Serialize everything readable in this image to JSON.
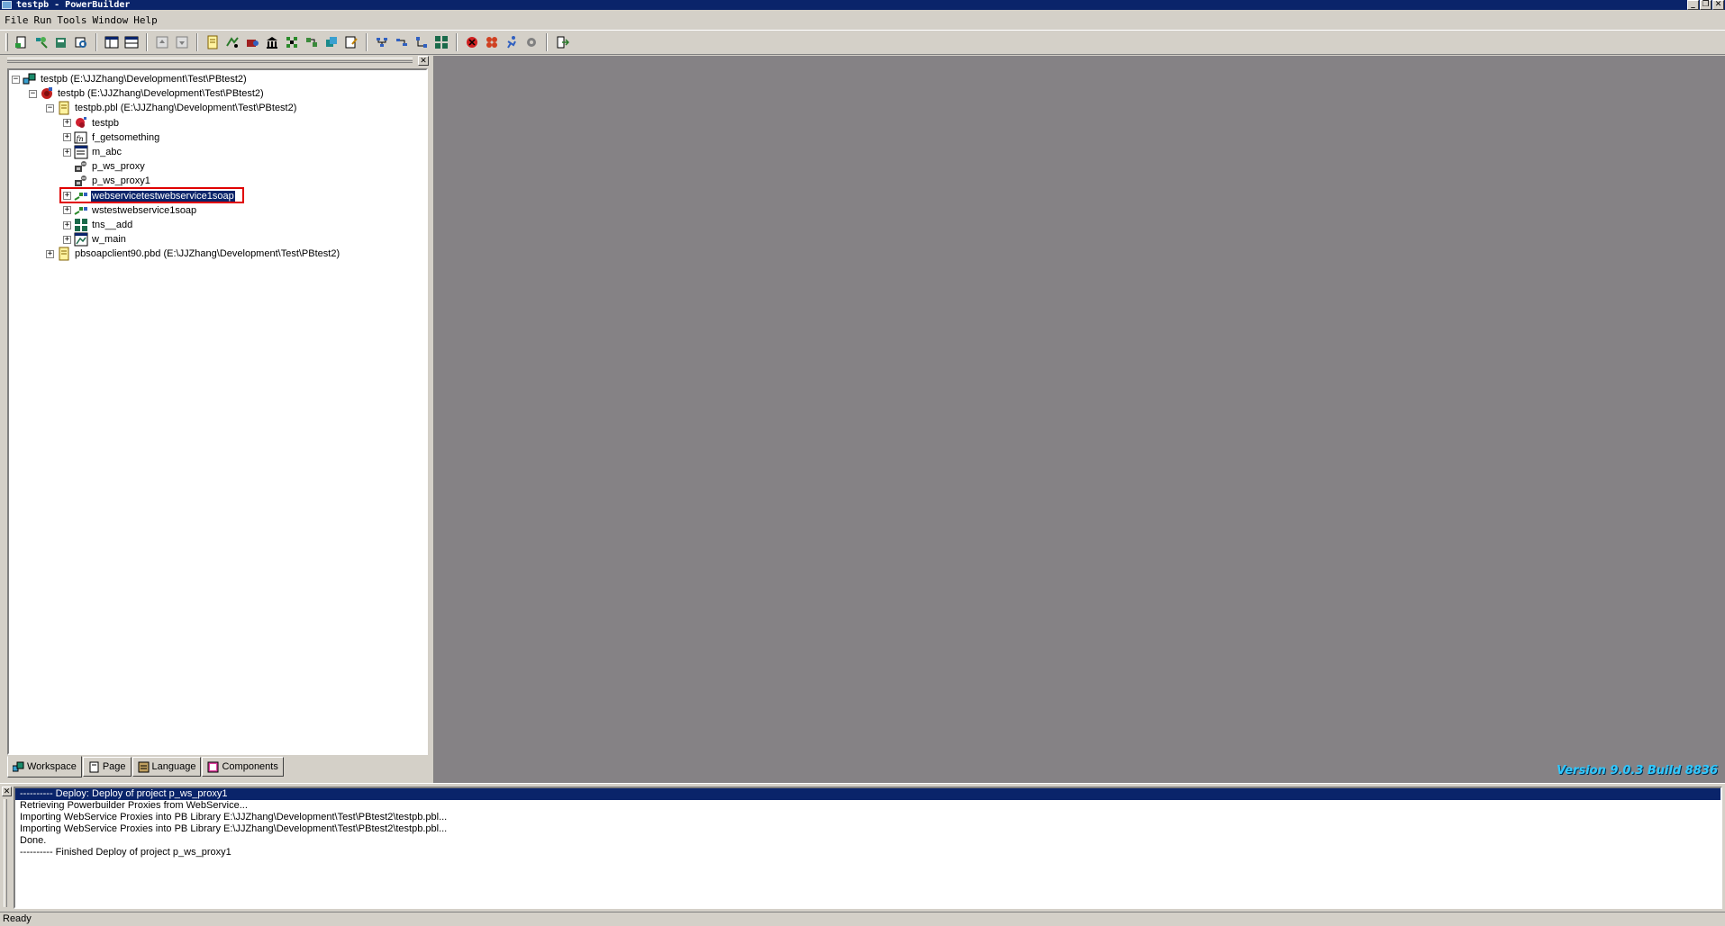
{
  "window": {
    "title": "testpb - PowerBuilder",
    "minimize_glyph": "_",
    "restore_glyph": "❐",
    "close_glyph": "✕"
  },
  "menu": [
    "File",
    "Run",
    "Tools",
    "Window",
    "Help"
  ],
  "toolbar_icons": [
    "new-icon",
    "inherit-icon",
    "open-icon",
    "preview-icon",
    "separator",
    "window-layout-icon",
    "view-layout-icon",
    "separator",
    "step-icon",
    "step-out-icon",
    "separator",
    "library-icon",
    "debug-icon",
    "run-icon",
    "db-icon",
    "component-icon",
    "build-icon",
    "deploy-icon",
    "edit-icon",
    "separator",
    "object-browser-icon",
    "window-painter-icon",
    "user-object-icon",
    "structure-icon",
    "separator",
    "stop-icon",
    "multi-run-icon",
    "runner-icon",
    "gear-icon",
    "separator",
    "exit-icon"
  ],
  "workspace": {
    "close_glyph": "✕",
    "tree": [
      {
        "label": "testpb (E:\\JJZhang\\Development\\Test\\PBtest2)",
        "icon": "workspace-icon",
        "expander": "−",
        "level": 0
      },
      {
        "label": "testpb (E:\\JJZhang\\Development\\Test\\PBtest2)",
        "icon": "target-icon",
        "expander": "−",
        "level": 1
      },
      {
        "label": "testpb.pbl (E:\\JJZhang\\Development\\Test\\PBtest2)",
        "icon": "library-icon",
        "expander": "−",
        "level": 2
      },
      {
        "label": "testpb",
        "icon": "application-icon",
        "expander": "+",
        "level": 3
      },
      {
        "label": "f_getsomething",
        "icon": "function-icon",
        "expander": "+",
        "level": 3
      },
      {
        "label": "m_abc",
        "icon": "menu-icon",
        "expander": "+",
        "level": 3
      },
      {
        "label": "p_ws_proxy",
        "icon": "project-icon",
        "expander": "",
        "level": 3
      },
      {
        "label": "p_ws_proxy1",
        "icon": "project-icon",
        "expander": "",
        "level": 3
      },
      {
        "label": "webservicetestwebservice1soap",
        "icon": "proxy-object-icon",
        "expander": "+",
        "level": 3,
        "selected": true
      },
      {
        "label": "wstestwebservice1soap",
        "icon": "proxy-object-icon",
        "expander": "+",
        "level": 3
      },
      {
        "label": "tns__add",
        "icon": "structure-icon",
        "expander": "+",
        "level": 3
      },
      {
        "label": "w_main",
        "icon": "window-icon",
        "expander": "+",
        "level": 3
      },
      {
        "label": "pbsoapclient90.pbd (E:\\JJZhang\\Development\\Test\\PBtest2)",
        "icon": "library-icon",
        "expander": "+",
        "level": 2
      }
    ],
    "tabs": [
      {
        "label": "Workspace",
        "icon": "workspace-tab-icon",
        "active": true
      },
      {
        "label": "Page",
        "icon": "page-tab-icon",
        "active": false
      },
      {
        "label": "Language",
        "icon": "language-tab-icon",
        "active": false
      },
      {
        "label": "Components",
        "icon": "components-tab-icon",
        "active": false
      }
    ]
  },
  "main_area": {
    "version_text": "Version 9.0.3 Build 8836"
  },
  "output": {
    "close_glyph": "✕",
    "lines": [
      "---------- Deploy: Deploy of project p_ws_proxy1",
      "Retrieving Powerbuilder Proxies from WebService...",
      "Importing WebService Proxies into PB Library E:\\JJZhang\\Development\\Test\\PBtest2\\testpb.pbl...",
      "Importing WebService Proxies into PB Library E:\\JJZhang\\Development\\Test\\PBtest2\\testpb.pbl...",
      "Done.",
      "---------- Finished Deploy of project p_ws_proxy1"
    ]
  },
  "status": {
    "text": "Ready"
  },
  "colors": {
    "title_bar": "#0a246a",
    "face": "#d4d0c8",
    "mdi_background": "#858285",
    "version_text": "#30c8ff",
    "highlight_outline": "#e00000"
  }
}
